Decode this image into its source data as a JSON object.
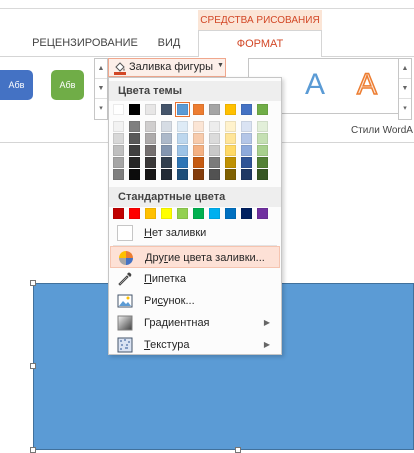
{
  "context_tab": "СРЕДСТВА РИСОВАНИЯ",
  "tabs": [
    {
      "label": "РЕЦЕНЗИРОВАНИЕ"
    },
    {
      "label": "ВИД"
    },
    {
      "label": "ФОРМАТ"
    }
  ],
  "ribbon": {
    "shape_style_1": "Абв",
    "shape_style_2": "Абв",
    "fill_button": "Заливка фигуры",
    "wordart_glyph": "A",
    "wordart_group_label": "Стили WordA"
  },
  "menu": {
    "theme_colors_header": "Цвета темы",
    "standard_colors_header": "Стандартные цвета",
    "theme_top_row": [
      "#ffffff",
      "#000000",
      "#e7e6e6",
      "#44546a",
      "#5b9bd5",
      "#ed7d31",
      "#a5a5a5",
      "#ffc000",
      "#4472c4",
      "#70ad47"
    ],
    "theme_shades": [
      [
        "#f2f2f2",
        "#7f7f7f",
        "#d0cece",
        "#d6dce4",
        "#deebf6",
        "#fbe5d5",
        "#ededed",
        "#fff2cc",
        "#dae3f3",
        "#e2efd9"
      ],
      [
        "#d8d8d8",
        "#595959",
        "#aeabab",
        "#adb9ca",
        "#bdd7ee",
        "#f7cbac",
        "#dbdbdb",
        "#ffe599",
        "#b4c6e7",
        "#c5e0b3"
      ],
      [
        "#bfbfbf",
        "#3f3f3f",
        "#757070",
        "#8496b0",
        "#9dc3e6",
        "#f4b183",
        "#c9c9c9",
        "#ffd966",
        "#8eaadb",
        "#a8d08d"
      ],
      [
        "#a5a5a5",
        "#262626",
        "#3a3838",
        "#323f4f",
        "#2e75b5",
        "#c55a11",
        "#7b7b7b",
        "#bf9000",
        "#2f5496",
        "#538135"
      ],
      [
        "#7f7f7f",
        "#0c0c0c",
        "#171616",
        "#222a35",
        "#1e4e79",
        "#833c0b",
        "#525252",
        "#7f6000",
        "#1f3864",
        "#375623"
      ]
    ],
    "standard_colors": [
      "#c00000",
      "#ff0000",
      "#ffc000",
      "#ffff00",
      "#92d050",
      "#00b050",
      "#00b0f0",
      "#0070c0",
      "#002060",
      "#7030a0"
    ],
    "no_fill": "Нет заливки",
    "more_colors": "Другие цвета заливки...",
    "eyedropper": "Пипетка",
    "picture": "Рисунок...",
    "gradient": "Градиентная",
    "texture": "Текстура"
  },
  "colors": {
    "accent_orange": "#d24726",
    "shape_fill": "#5b9bd5",
    "shape_border": "#41719c",
    "style_blue": "#4472c4",
    "style_green": "#70ad47",
    "wordart_blue": "#5b9bd5",
    "wordart_orange": "#ed7d31"
  },
  "icons": {
    "fill_bucket": "paint-bucket-icon",
    "color_wheel": "color-wheel-icon",
    "eyedropper": "eyedropper-icon",
    "picture": "picture-icon",
    "gradient": "gradient-icon",
    "texture": "texture-icon"
  }
}
